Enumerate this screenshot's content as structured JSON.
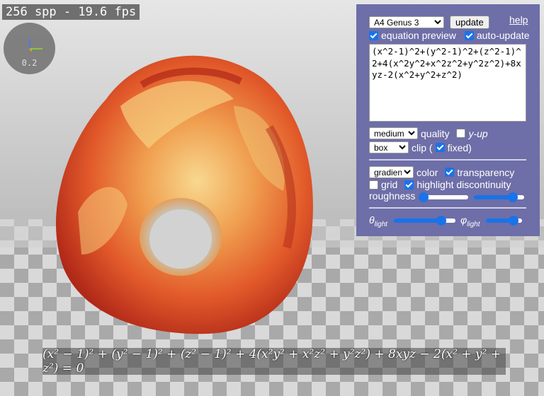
{
  "render": {
    "fps_text": "256 spp - 19.6 fps",
    "axes_scale": "0.2"
  },
  "panel": {
    "preset_selected": "A4 Genus 3",
    "update_label": "update",
    "help_label": "help",
    "equation_preview": {
      "label": "equation preview",
      "checked": true
    },
    "auto_update": {
      "label": "auto-update",
      "checked": true
    },
    "equation_text": "(x^2-1)^2+(y^2-1)^2+(z^2-1)^2+4(x^2y^2+x^2z^2+y^2z^2)+8xyz-2(x^2+y^2+z^2)",
    "quality_selected": "medium",
    "quality_label": "quality",
    "y_up": {
      "label": "y-up",
      "checked": false
    },
    "clip_selected": "box",
    "clip_label": "clip (",
    "fixed": {
      "label": "fixed)",
      "checked": true
    },
    "color_selected": "gradient",
    "color_label": "color",
    "transparency": {
      "label": "transparency",
      "checked": true
    },
    "grid": {
      "label": "grid",
      "checked": false
    },
    "highlight_discontinuity": {
      "label": "highlight discontinuity",
      "checked": true
    },
    "roughness_label": "roughness",
    "roughness_value": 0.0,
    "roughness2_value": 0.85,
    "theta_label": "θ",
    "theta_sub": "light",
    "theta_value": 0.82,
    "phi_label": "φ",
    "phi_sub": "light",
    "phi_value": 0.88
  },
  "preview_equation": "(x² − 1)² + (y² − 1)² + (z² − 1)² + 4(x²y² + x²z² + y²z²) + 8xyz − 2(x² + y² + z²) = 0",
  "colors": {
    "panel_bg": "#6e6ea8",
    "accent": "#1a73e8"
  }
}
